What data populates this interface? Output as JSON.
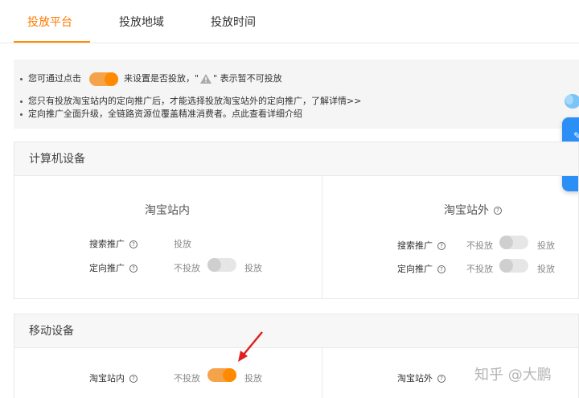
{
  "tabs": [
    {
      "label": "投放平台",
      "active": true
    },
    {
      "label": "投放地域",
      "active": false
    },
    {
      "label": "投放时间",
      "active": false
    }
  ],
  "notice": {
    "line1_prefix": "您可通过点击",
    "line1_mid": "来设置是否投放，\"",
    "line1_suffix": "\" 表示暂不可投放",
    "line2_text": "您只有投放淘宝站内的定向推广后，才能选择投放淘宝站外的定向推广，",
    "line2_link": "了解详情>>",
    "line3_text": "定向推广全面升级，全链路资源位覆盖精准消费者。点此查看详细介绍"
  },
  "pc_section": {
    "title": "计算机设备",
    "left": {
      "title": "淘宝站内",
      "rows": [
        {
          "label": "搜索推广",
          "off_label": "",
          "on_label": "投放",
          "has_toggle": false
        },
        {
          "label": "定向推广",
          "off_label": "不投放",
          "on_label": "投放",
          "has_toggle": true,
          "on": false
        }
      ]
    },
    "right": {
      "title": "淘宝站外",
      "rows": [
        {
          "label": "搜索推广",
          "off_label": "不投放",
          "on_label": "投放",
          "has_toggle": true,
          "on": false
        },
        {
          "label": "定向推广",
          "off_label": "不投放",
          "on_label": "投放",
          "has_toggle": true,
          "on": false
        }
      ]
    }
  },
  "mobile_section": {
    "title": "移动设备",
    "left": {
      "label": "淘宝站内",
      "off_label": "不投放",
      "on_label": "投放",
      "on": true
    },
    "right": {
      "label": "淘宝站外"
    }
  },
  "watermark": "知乎 @大鹏",
  "colors": {
    "accent": "#ff8a00",
    "toggle_on_track": "#f5a34a",
    "widget_blue": "#2b8ff5",
    "annotation_red": "#e02020"
  }
}
